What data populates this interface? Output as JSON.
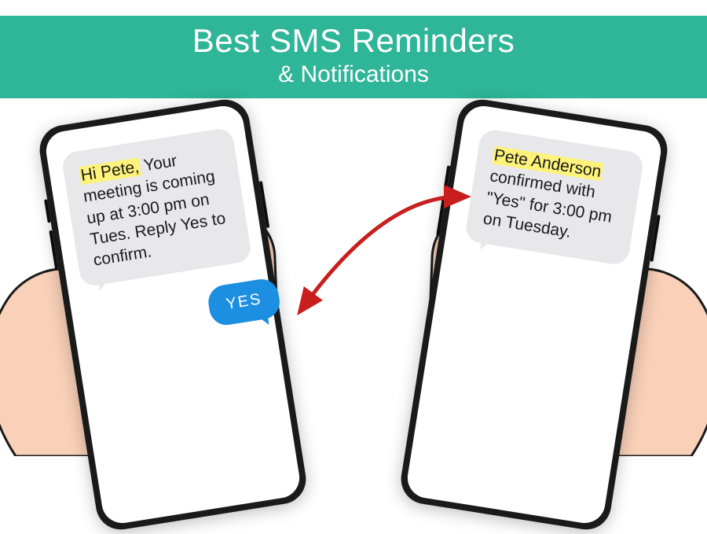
{
  "banner": {
    "title": "Best SMS Reminders",
    "subtitle": "& Notifications"
  },
  "leftPhone": {
    "highlight": "Hi Pete,",
    "message_rest": " Your meeting is coming up at 3:00 pm on Tues. Reply Yes to confirm.",
    "reply": "YES"
  },
  "rightPhone": {
    "highlight": "Pete Anderson",
    "message_rest": " confirmed with \"Yes\" for 3:00 pm on Tuesday."
  },
  "colors": {
    "banner": "#2fb597",
    "highlight": "#fdf27a",
    "reply_bubble": "#1d8fe1",
    "arrow": "#c81e1e"
  }
}
